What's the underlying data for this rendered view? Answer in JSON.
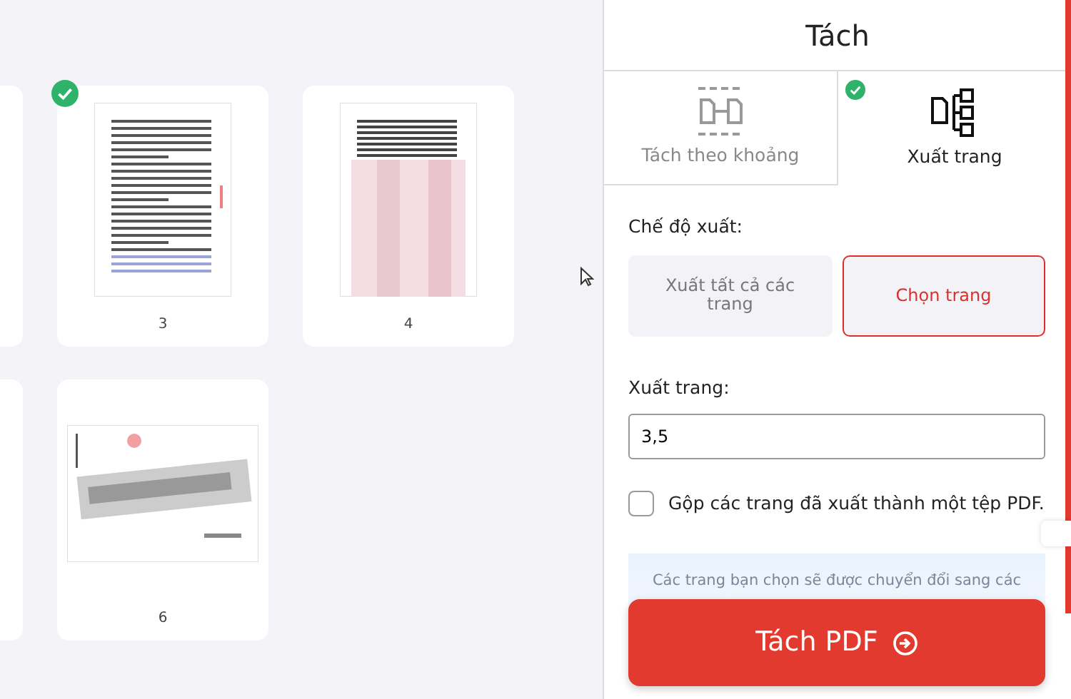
{
  "page_rows": [
    {
      "pages": [
        {
          "number": "3",
          "selected": true,
          "kind": "text"
        },
        {
          "number": "4",
          "selected": false,
          "kind": "blurred"
        }
      ]
    },
    {
      "pages": [
        {
          "number": "6",
          "selected": false,
          "kind": "landscape"
        }
      ]
    }
  ],
  "panel": {
    "title": "Tách",
    "tabs": [
      {
        "label": "Tách theo khoảng",
        "selected": false
      },
      {
        "label": "Xuất trang",
        "selected": true
      }
    ],
    "mode_label": "Chế độ xuất:",
    "modes": [
      {
        "label": "Xuất tất cả các trang",
        "selected": false
      },
      {
        "label": "Chọn trang",
        "selected": true
      }
    ],
    "pages_label": "Xuất trang:",
    "pages_value": "3,5",
    "merge": {
      "label": "Gộp các trang đã xuất thành một tệp PDF.",
      "checked": false
    },
    "info": "Các trang bạn chọn sẽ được chuyển đổi sang các",
    "submit": "Tách PDF"
  }
}
